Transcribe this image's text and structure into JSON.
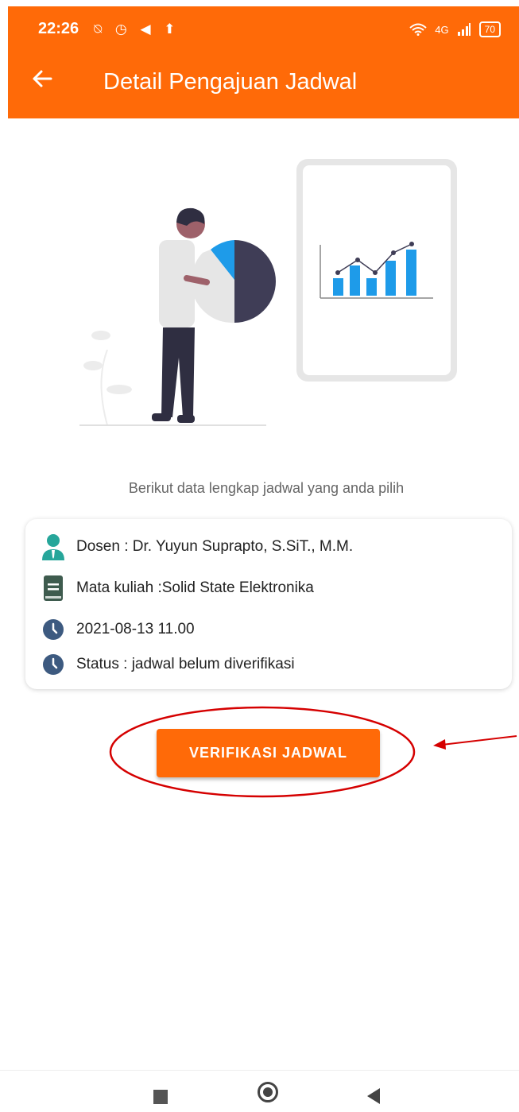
{
  "status_bar": {
    "time": "22:26",
    "left_icons": "⍉ ◷ ◀ ⬆",
    "signal": "4G",
    "battery": "70"
  },
  "header": {
    "title": "Detail Pengajuan Jadwal",
    "back_icon": "arrow-left-icon"
  },
  "caption": "Berikut data lengkap jadwal yang anda pilih",
  "details": {
    "dosen": "Dosen : Dr. Yuyun Suprapto, S.SiT., M.M.",
    "matkul": "Mata kuliah :Solid State Elektronika",
    "datetime": "2021-08-13 11.00",
    "status": "Status : jadwal belum diverifikasi"
  },
  "button": {
    "label": "VERIFIKASI JADWAL"
  },
  "colors": {
    "primary": "#FF6A08",
    "teal": "#26A69A",
    "book": "#3E5B4E",
    "clock": "#3D5A80",
    "annotation": "#D50000"
  }
}
